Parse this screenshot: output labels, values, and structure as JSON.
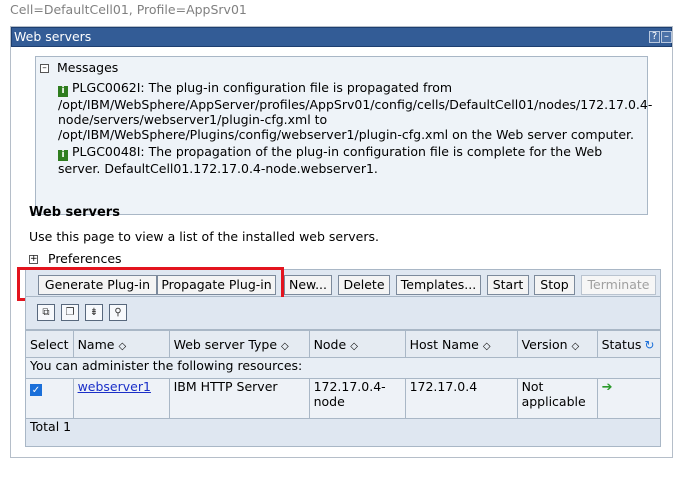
{
  "header": {
    "cell_line": "Cell=DefaultCell01, Profile=AppSrv01"
  },
  "portlet": {
    "title": "Web servers",
    "help_icon_label": "?",
    "minimize_icon_label": "–"
  },
  "messages": {
    "heading": "Messages",
    "toggle": "–",
    "info_icon": "i",
    "items": [
      "PLGC0062I: The plug-in configuration file is propagated from /opt/IBM/WebSphere/AppServer/profiles/AppSrv01/config/cells/DefaultCell01/nodes/172.17.0.4-node/servers/webserver1/plugin-cfg.xml to /opt/IBM/WebSphere/Plugins/config/webserver1/plugin-cfg.xml on the Web server computer.",
      "PLGC0048I: The propagation of the plug-in configuration file is complete for the Web server. DefaultCell01.172.17.0.4-node.webserver1."
    ]
  },
  "section": {
    "title": "Web servers",
    "description": "Use this page to view a list of the installed web servers.",
    "preferences_label": "Preferences",
    "preferences_toggle": "+"
  },
  "buttons": {
    "generate": "Generate Plug-in",
    "propagate": "Propagate Plug-in",
    "new": "New...",
    "delete": "Delete",
    "templates": "Templates...",
    "start": "Start",
    "stop": "Stop",
    "terminate": "Terminate"
  },
  "table": {
    "columns": {
      "select": "Select",
      "name": "Name",
      "type": "Web server Type",
      "node": "Node",
      "host": "Host Name",
      "version": "Version",
      "status": "Status"
    },
    "sort_glyph": "◇",
    "resources_text": "You can administer the following resources:",
    "rows": [
      {
        "name": "webserver1",
        "type": "IBM HTTP Server",
        "node": "172.17.0.4-node",
        "host": "172.17.0.4",
        "version": "Not applicable",
        "status_icon": "green-arrow-icon",
        "selected": true
      }
    ],
    "total_label": "Total 1"
  },
  "colors": {
    "title_bar": "#335c96",
    "highlight_border": "#e3141e",
    "link": "#1a2fc8"
  }
}
